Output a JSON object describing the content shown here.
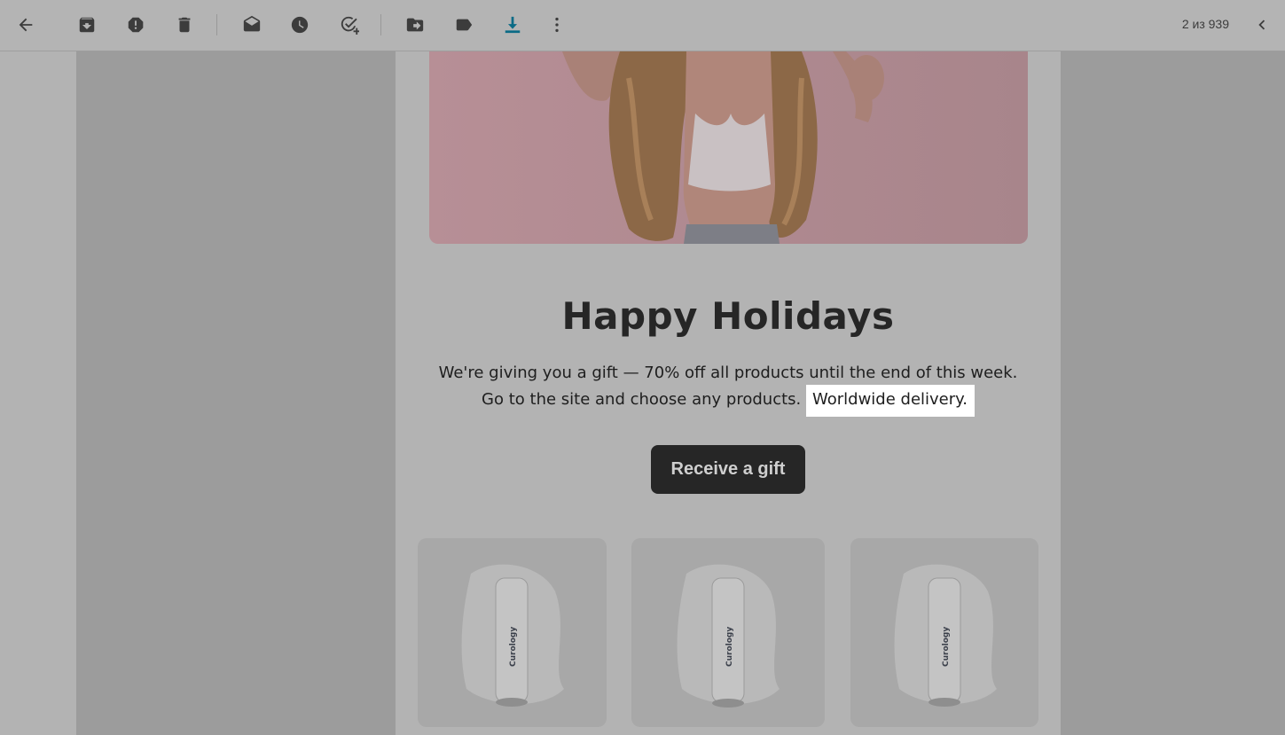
{
  "toolbar": {
    "back_icon": "arrow-left-icon",
    "archive_icon": "archive-icon",
    "spam_icon": "report-spam-icon",
    "delete_icon": "trash-icon",
    "mark_unread_icon": "mark-unread-icon",
    "snooze_icon": "clock-icon",
    "add_task_icon": "add-task-icon",
    "move_icon": "move-to-icon",
    "label_icon": "label-icon",
    "download_icon": "download-icon",
    "more_icon": "more-vert-icon",
    "prev_icon": "chevron-left-icon",
    "count_text": "2 из 939",
    "download_color": "#0b6b86"
  },
  "email": {
    "headline": "Happy Holidays",
    "body_line1": "We're giving you a gift — 70% off all products until the end of this week.",
    "body_line2_start": "Go to the site and choose any products. ",
    "body_line2_highlight": "Worldwide delivery.",
    "cta_label": "Receive a gift",
    "product_brand": "Curology"
  }
}
